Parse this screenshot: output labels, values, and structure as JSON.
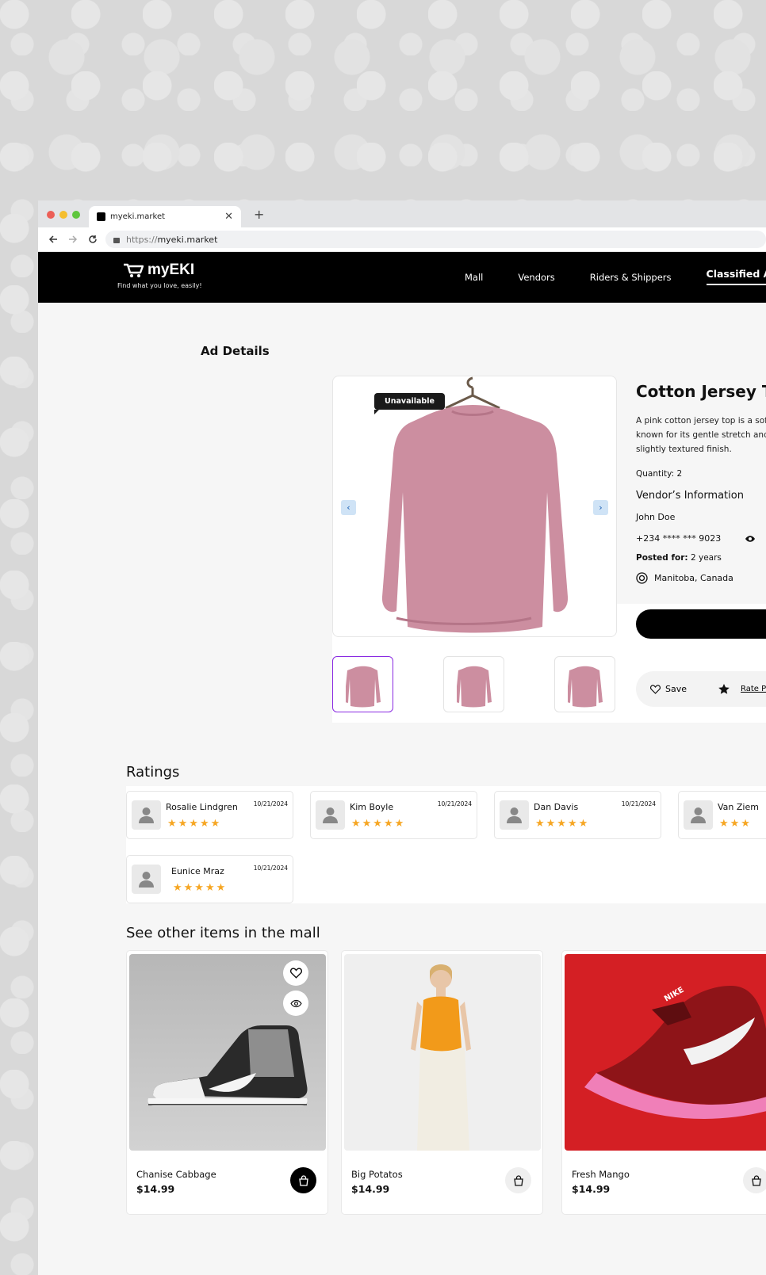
{
  "browser": {
    "tab_title": "myeki.market",
    "url_scheme": "https://",
    "url_host": "myeki.market"
  },
  "header": {
    "brand": "myEKI",
    "tagline": "Find what you love, easily!",
    "nav": [
      "Mall",
      "Vendors",
      "Riders & Shippers",
      "Classified A"
    ]
  },
  "page": {
    "heading": "Ad Details",
    "badge": "Unavailable",
    "title": "Cotton Jersey Top",
    "description_lines": [
      "A pink cotton jersey top is a soft,",
      "known for its gentle stretch and b",
      "slightly textured finish."
    ],
    "quantity": "Quantity: 2",
    "vendor_heading": "Vendor’s Information",
    "vendor_name": "John Doe",
    "vendor_phone": "+234 **** *** 9023",
    "posted_label": "Posted for:",
    "posted_value": " 2 years",
    "location": "Manitoba, Canada",
    "save_label": "Save",
    "rate_label": "Rate Pr"
  },
  "ratings": {
    "heading": "Ratings",
    "items": [
      {
        "name": "Rosalie Lindgren",
        "date": "10/21/2024",
        "stars": "★★★★★"
      },
      {
        "name": "Kim Boyle",
        "date": "10/21/2024",
        "stars": "★★★★★"
      },
      {
        "name": "Dan Davis",
        "date": "10/21/2024",
        "stars": "★★★★★"
      },
      {
        "name": "Van Ziem",
        "date": "",
        "stars": "★★★"
      },
      {
        "name": "Eunice Mraz",
        "date": "10/21/2024",
        "stars": "★★★★★"
      }
    ]
  },
  "mall": {
    "heading": "See other items in the mall",
    "items": [
      {
        "name": "Chanise Cabbage",
        "price": "$14.99"
      },
      {
        "name": "Big Potatos",
        "price": "$14.99"
      },
      {
        "name": "Fresh Mango",
        "price": "$14.99"
      }
    ]
  },
  "colors": {
    "accent": "#8a2be2",
    "star": "#f6a623",
    "header_bg": "#000000"
  }
}
